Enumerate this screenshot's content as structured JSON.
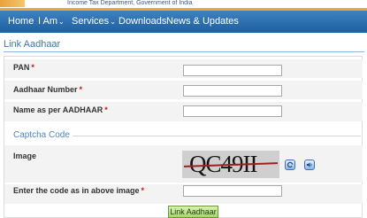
{
  "header": {
    "department": "Income Tax Department, Government of India"
  },
  "nav": {
    "home": "Home",
    "iam": "I Am",
    "services": "Services",
    "downloads": "Downloads",
    "news": "News & Updates"
  },
  "page": {
    "title": "Link Aadhaar"
  },
  "form": {
    "pan_label": "PAN",
    "aadhaar_label": "Aadhaar Number",
    "name_label": "Name as per AADHAAR",
    "required_mark": "*",
    "captcha_section": "Captcha Code",
    "image_label": "Image",
    "captcha_text": "QC49II",
    "enter_code_label": "Enter the code as in above image",
    "submit_label": "Link Aadhaar"
  },
  "colors": {
    "nav_bg": "#2a6aa8",
    "section_title": "#3778b8",
    "required": "#d21414",
    "button_bg": "#b6df7c"
  },
  "icons": {
    "refresh": "refresh-icon",
    "audio": "audio-icon"
  }
}
